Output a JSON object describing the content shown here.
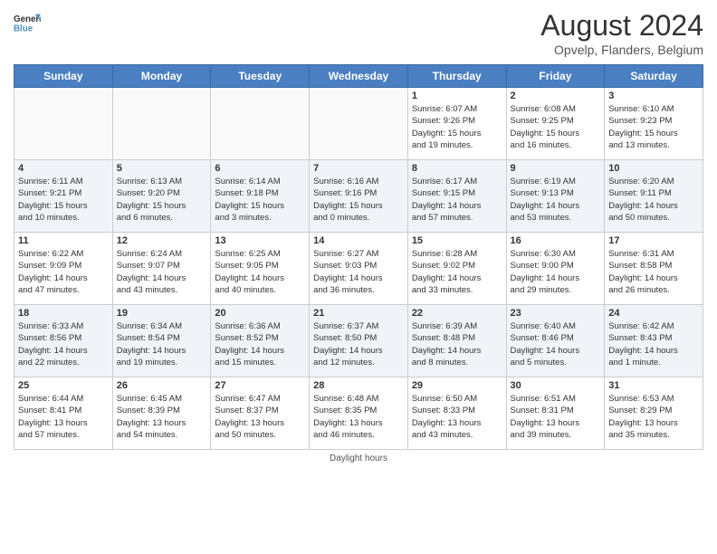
{
  "header": {
    "logo_line1": "General",
    "logo_line2": "Blue",
    "month": "August 2024",
    "location": "Opvelp, Flanders, Belgium"
  },
  "days_of_week": [
    "Sunday",
    "Monday",
    "Tuesday",
    "Wednesday",
    "Thursday",
    "Friday",
    "Saturday"
  ],
  "weeks": [
    [
      {
        "day": "",
        "info": ""
      },
      {
        "day": "",
        "info": ""
      },
      {
        "day": "",
        "info": ""
      },
      {
        "day": "",
        "info": ""
      },
      {
        "day": "1",
        "info": "Sunrise: 6:07 AM\nSunset: 9:26 PM\nDaylight: 15 hours\nand 19 minutes."
      },
      {
        "day": "2",
        "info": "Sunrise: 6:08 AM\nSunset: 9:25 PM\nDaylight: 15 hours\nand 16 minutes."
      },
      {
        "day": "3",
        "info": "Sunrise: 6:10 AM\nSunset: 9:23 PM\nDaylight: 15 hours\nand 13 minutes."
      }
    ],
    [
      {
        "day": "4",
        "info": "Sunrise: 6:11 AM\nSunset: 9:21 PM\nDaylight: 15 hours\nand 10 minutes."
      },
      {
        "day": "5",
        "info": "Sunrise: 6:13 AM\nSunset: 9:20 PM\nDaylight: 15 hours\nand 6 minutes."
      },
      {
        "day": "6",
        "info": "Sunrise: 6:14 AM\nSunset: 9:18 PM\nDaylight: 15 hours\nand 3 minutes."
      },
      {
        "day": "7",
        "info": "Sunrise: 6:16 AM\nSunset: 9:16 PM\nDaylight: 15 hours\nand 0 minutes."
      },
      {
        "day": "8",
        "info": "Sunrise: 6:17 AM\nSunset: 9:15 PM\nDaylight: 14 hours\nand 57 minutes."
      },
      {
        "day": "9",
        "info": "Sunrise: 6:19 AM\nSunset: 9:13 PM\nDaylight: 14 hours\nand 53 minutes."
      },
      {
        "day": "10",
        "info": "Sunrise: 6:20 AM\nSunset: 9:11 PM\nDaylight: 14 hours\nand 50 minutes."
      }
    ],
    [
      {
        "day": "11",
        "info": "Sunrise: 6:22 AM\nSunset: 9:09 PM\nDaylight: 14 hours\nand 47 minutes."
      },
      {
        "day": "12",
        "info": "Sunrise: 6:24 AM\nSunset: 9:07 PM\nDaylight: 14 hours\nand 43 minutes."
      },
      {
        "day": "13",
        "info": "Sunrise: 6:25 AM\nSunset: 9:05 PM\nDaylight: 14 hours\nand 40 minutes."
      },
      {
        "day": "14",
        "info": "Sunrise: 6:27 AM\nSunset: 9:03 PM\nDaylight: 14 hours\nand 36 minutes."
      },
      {
        "day": "15",
        "info": "Sunrise: 6:28 AM\nSunset: 9:02 PM\nDaylight: 14 hours\nand 33 minutes."
      },
      {
        "day": "16",
        "info": "Sunrise: 6:30 AM\nSunset: 9:00 PM\nDaylight: 14 hours\nand 29 minutes."
      },
      {
        "day": "17",
        "info": "Sunrise: 6:31 AM\nSunset: 8:58 PM\nDaylight: 14 hours\nand 26 minutes."
      }
    ],
    [
      {
        "day": "18",
        "info": "Sunrise: 6:33 AM\nSunset: 8:56 PM\nDaylight: 14 hours\nand 22 minutes."
      },
      {
        "day": "19",
        "info": "Sunrise: 6:34 AM\nSunset: 8:54 PM\nDaylight: 14 hours\nand 19 minutes."
      },
      {
        "day": "20",
        "info": "Sunrise: 6:36 AM\nSunset: 8:52 PM\nDaylight: 14 hours\nand 15 minutes."
      },
      {
        "day": "21",
        "info": "Sunrise: 6:37 AM\nSunset: 8:50 PM\nDaylight: 14 hours\nand 12 minutes."
      },
      {
        "day": "22",
        "info": "Sunrise: 6:39 AM\nSunset: 8:48 PM\nDaylight: 14 hours\nand 8 minutes."
      },
      {
        "day": "23",
        "info": "Sunrise: 6:40 AM\nSunset: 8:46 PM\nDaylight: 14 hours\nand 5 minutes."
      },
      {
        "day": "24",
        "info": "Sunrise: 6:42 AM\nSunset: 8:43 PM\nDaylight: 14 hours\nand 1 minute."
      }
    ],
    [
      {
        "day": "25",
        "info": "Sunrise: 6:44 AM\nSunset: 8:41 PM\nDaylight: 13 hours\nand 57 minutes."
      },
      {
        "day": "26",
        "info": "Sunrise: 6:45 AM\nSunset: 8:39 PM\nDaylight: 13 hours\nand 54 minutes."
      },
      {
        "day": "27",
        "info": "Sunrise: 6:47 AM\nSunset: 8:37 PM\nDaylight: 13 hours\nand 50 minutes."
      },
      {
        "day": "28",
        "info": "Sunrise: 6:48 AM\nSunset: 8:35 PM\nDaylight: 13 hours\nand 46 minutes."
      },
      {
        "day": "29",
        "info": "Sunrise: 6:50 AM\nSunset: 8:33 PM\nDaylight: 13 hours\nand 43 minutes."
      },
      {
        "day": "30",
        "info": "Sunrise: 6:51 AM\nSunset: 8:31 PM\nDaylight: 13 hours\nand 39 minutes."
      },
      {
        "day": "31",
        "info": "Sunrise: 6:53 AM\nSunset: 8:29 PM\nDaylight: 13 hours\nand 35 minutes."
      }
    ]
  ],
  "footer": "Daylight hours"
}
